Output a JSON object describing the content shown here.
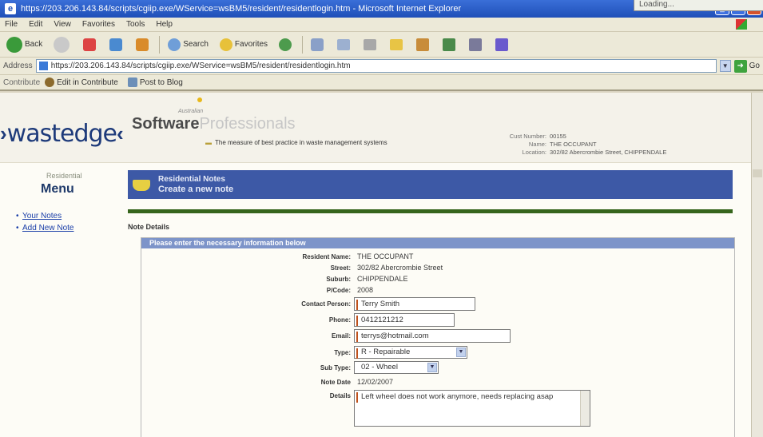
{
  "window": {
    "title": "https://203.206.143.84/scripts/cgiip.exe/WService=wsBM5/resident/residentlogin.htm - Microsoft Internet Explorer",
    "corner_tab": "Loading..."
  },
  "menu": [
    "File",
    "Edit",
    "View",
    "Favorites",
    "Tools",
    "Help"
  ],
  "toolbar": {
    "back": "Back",
    "search": "Search",
    "favorites": "Favorites"
  },
  "address": {
    "label": "Address",
    "url": "https://203.206.143.84/scripts/cgiip.exe/WService=wsBM5/resident/residentlogin.htm",
    "go": "Go"
  },
  "contribute": {
    "label": "Contribute",
    "edit": "Edit in Contribute",
    "post": "Post to Blog"
  },
  "site": {
    "logo": "wastedge",
    "brand_small": "Australian",
    "brand_software": "Software",
    "brand_professionals": "Professionals",
    "tagline": "The measure of best practice in waste management systems",
    "cust_rows": [
      {
        "k": "Cust Number:",
        "v": "00155"
      },
      {
        "k": "Name:",
        "v": "THE OCCUPANT"
      },
      {
        "k": "Location:",
        "v": "302/82 Abercrombie Street, CHIPPENDALE"
      }
    ]
  },
  "leftmenu": {
    "caption_small": "Residential",
    "caption_big": "Menu",
    "items": [
      "Your Notes",
      "Add New Note"
    ]
  },
  "note_header": {
    "line1": "Residential Notes",
    "line2": "Create a new note"
  },
  "form": {
    "section_title": "Note Details",
    "bar_title": "Please enter the necessary information below",
    "resident_name_label": "Resident Name:",
    "resident_name": "THE OCCUPANT",
    "street_label": "Street:",
    "street": "302/82 Abercrombie Street",
    "suburb_label": "Suburb:",
    "suburb": "CHIPPENDALE",
    "pcode_label": "P/Code:",
    "pcode": "2008",
    "contact_label": "Contact Person:",
    "contact": "Terry Smith",
    "phone_label": "Phone:",
    "phone": "0412121212",
    "email_label": "Email:",
    "email": "terrys@hotmail.com",
    "type_label": "Type:",
    "type": "R - Repairable",
    "subtype_label": "Sub Type:",
    "subtype": "02 - Wheel",
    "notedate_label": "Note Date",
    "notedate": "12/02/2007",
    "details_label": "Details",
    "details": "Left wheel does not work anymore, needs replacing asap"
  }
}
